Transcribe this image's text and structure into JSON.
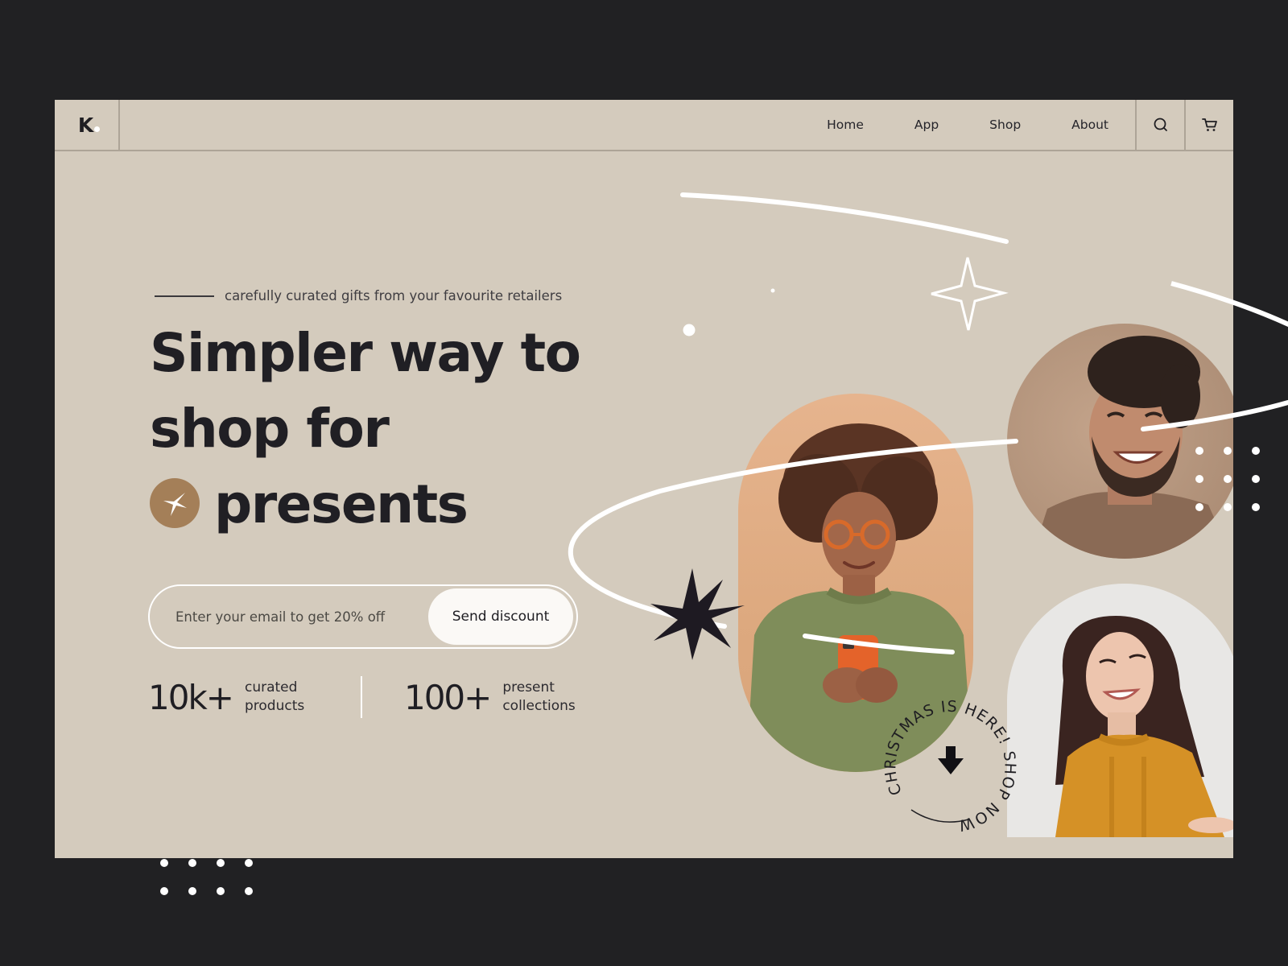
{
  "brand": {
    "logo_letter": "K"
  },
  "nav": {
    "items": [
      {
        "label": "Home"
      },
      {
        "label": "App"
      },
      {
        "label": "Shop"
      },
      {
        "label": "About"
      }
    ],
    "icons": [
      "search-icon",
      "cart-icon"
    ]
  },
  "hero": {
    "eyebrow": "carefully curated gifts from your favourite retailers",
    "headline": {
      "line1": "Simpler way to",
      "line2": "shop for",
      "line3": "presents"
    },
    "badge_icon": "sparkle-icon"
  },
  "email_form": {
    "placeholder": "Enter your email to get 20% off",
    "value": "",
    "button_label": "Send discount"
  },
  "stats": [
    {
      "value": "10k+",
      "label_line1": "curated",
      "label_line2": "products"
    },
    {
      "value": "100+",
      "label_line1": "present",
      "label_line2": "collections"
    }
  ],
  "promo": {
    "circular_text": "CHRISTMAS IS HERE! SHOP NOW",
    "icon": "arrow-down-icon"
  },
  "images": [
    {
      "name": "woman-with-phone",
      "alt": "Smiling woman with curly hair and glasses looking at an orange phone"
    },
    {
      "name": "smiling-man",
      "alt": "Laughing man with curly dark hair in brown t-shirt"
    },
    {
      "name": "woman-in-sweater",
      "alt": "Smiling woman with long dark hair in mustard cable-knit sweater"
    }
  ],
  "colors": {
    "page_bg": "#212123",
    "frame_bg": "#D4CBBD",
    "text_dark": "#201F24",
    "accent_brown": "#A47F58",
    "white": "#FFFFFF"
  }
}
